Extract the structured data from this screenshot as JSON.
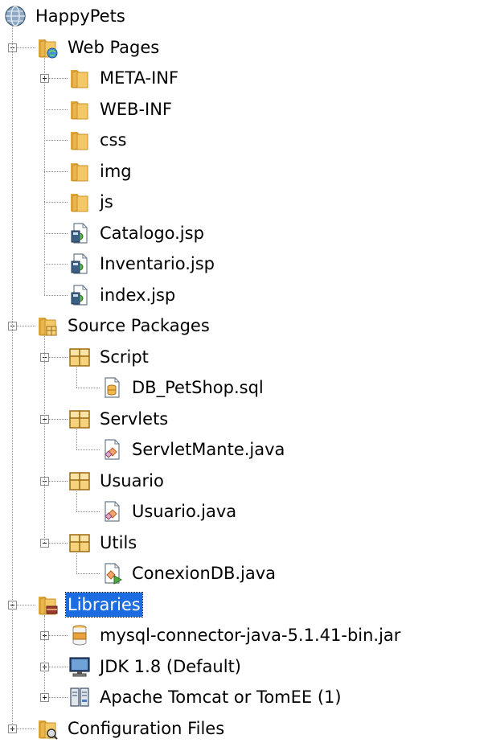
{
  "tree": [
    {
      "label": "HappyPets",
      "level": 0,
      "icon": "globe-project-icon",
      "toggle": "none",
      "line_end": false,
      "selected": false
    },
    {
      "label": "Web Pages",
      "level": 1,
      "icon": "web-folder-icon",
      "toggle": "minus",
      "line_end": false,
      "selected": false
    },
    {
      "label": "META-INF",
      "level": 2,
      "icon": "folder-icon",
      "toggle": "plus",
      "line_end": false,
      "selected": false
    },
    {
      "label": "WEB-INF",
      "level": 2,
      "icon": "folder-icon",
      "toggle": "none",
      "line_end": false,
      "selected": false
    },
    {
      "label": "css",
      "level": 2,
      "icon": "folder-icon",
      "toggle": "none",
      "line_end": false,
      "selected": false
    },
    {
      "label": "img",
      "level": 2,
      "icon": "folder-icon",
      "toggle": "none",
      "line_end": false,
      "selected": false
    },
    {
      "label": "js",
      "level": 2,
      "icon": "folder-icon",
      "toggle": "none",
      "line_end": false,
      "selected": false
    },
    {
      "label": "Catalogo.jsp",
      "level": 2,
      "icon": "jsp-file-icon",
      "toggle": "none",
      "line_end": false,
      "selected": false
    },
    {
      "label": "Inventario.jsp",
      "level": 2,
      "icon": "jsp-file-icon",
      "toggle": "none",
      "line_end": false,
      "selected": false
    },
    {
      "label": "index.jsp",
      "level": 2,
      "icon": "jsp-file-icon",
      "toggle": "none",
      "line_end": true,
      "selected": false
    },
    {
      "label": "Source Packages",
      "level": 1,
      "icon": "source-packages-icon",
      "toggle": "minus",
      "line_end": false,
      "selected": false
    },
    {
      "label": "Script",
      "level": 2,
      "icon": "package-icon",
      "toggle": "minus",
      "line_end": false,
      "selected": false
    },
    {
      "label": "DB_PetShop.sql",
      "level": 3,
      "icon": "sql-file-icon",
      "toggle": "none",
      "line_end": true,
      "selected": false
    },
    {
      "label": "Servlets",
      "level": 2,
      "icon": "package-icon",
      "toggle": "minus",
      "line_end": false,
      "selected": false
    },
    {
      "label": "ServletMante.java",
      "level": 3,
      "icon": "java-file-icon",
      "toggle": "none",
      "line_end": true,
      "selected": false
    },
    {
      "label": "Usuario",
      "level": 2,
      "icon": "package-icon",
      "toggle": "minus",
      "line_end": false,
      "selected": false
    },
    {
      "label": "Usuario.java",
      "level": 3,
      "icon": "java-file-icon",
      "toggle": "none",
      "line_end": true,
      "selected": false
    },
    {
      "label": "Utils",
      "level": 2,
      "icon": "package-icon",
      "toggle": "minus",
      "line_end": true,
      "selected": false
    },
    {
      "label": "ConexionDB.java",
      "level": 3,
      "icon": "java-main-file-icon",
      "toggle": "none",
      "line_end": true,
      "selected": false
    },
    {
      "label": "Libraries",
      "level": 1,
      "icon": "libraries-folder-icon",
      "toggle": "minus",
      "line_end": false,
      "selected": true
    },
    {
      "label": "mysql-connector-java-5.1.41-bin.jar",
      "level": 2,
      "icon": "jar-icon",
      "toggle": "plus",
      "line_end": false,
      "selected": false
    },
    {
      "label": "JDK 1.8 (Default)",
      "level": 2,
      "icon": "jdk-monitor-icon",
      "toggle": "plus",
      "line_end": false,
      "selected": false
    },
    {
      "label": "Apache Tomcat or TomEE (1)",
      "level": 2,
      "icon": "server-library-icon",
      "toggle": "plus",
      "line_end": true,
      "selected": false
    },
    {
      "label": "Configuration Files",
      "level": 1,
      "icon": "config-folder-icon",
      "toggle": "plus",
      "line_end": false,
      "selected": false
    }
  ],
  "colors": {
    "selection": "#1b6ce0",
    "folder": "#f0c25a",
    "folder_dark": "#c8922a",
    "tree_line": "#8a8a8a"
  }
}
